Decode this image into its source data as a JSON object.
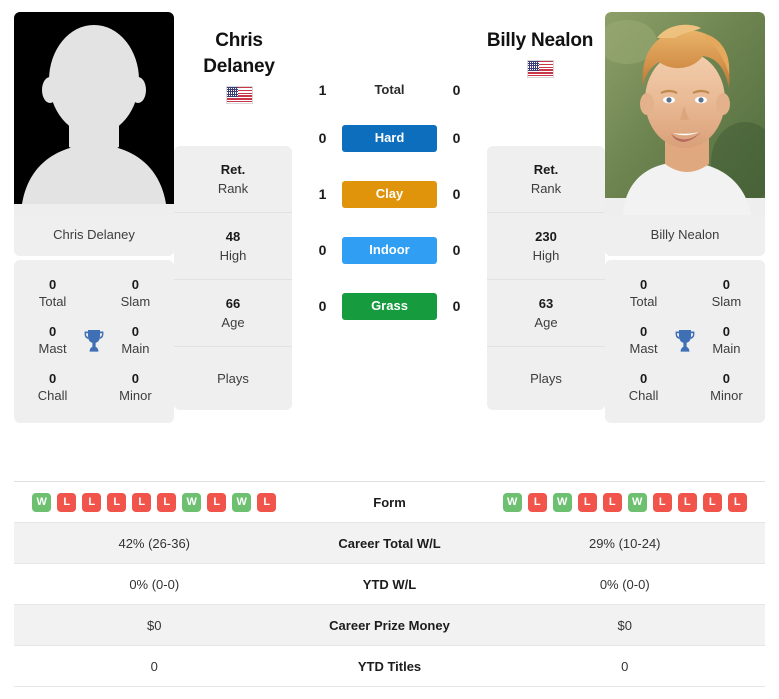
{
  "players": {
    "left": {
      "name_line1": "Chris",
      "name_line2": "Delaney",
      "full_name": "Chris Delaney",
      "country": "United States",
      "photo_type": "silhouette-placeholder",
      "rank": "Ret.",
      "rank_label": "Rank",
      "high": "48",
      "high_label": "High",
      "age": "66",
      "age_label": "Age",
      "plays": "Plays",
      "titles": {
        "total": "0",
        "total_label": "Total",
        "slam": "0",
        "slam_label": "Slam",
        "mast": "0",
        "mast_label": "Mast",
        "main": "0",
        "main_label": "Main",
        "chall": "0",
        "chall_label": "Chall",
        "minor": "0",
        "minor_label": "Minor"
      },
      "form": [
        "W",
        "L",
        "L",
        "L",
        "L",
        "L",
        "W",
        "L",
        "W",
        "L"
      ],
      "career_total_wl": "42% (26-36)",
      "ytd_wl": "0% (0-0)",
      "career_prize_money": "$0",
      "ytd_titles": "0"
    },
    "right": {
      "name_line1": "Billy Nealon",
      "name_line2": "",
      "full_name": "Billy Nealon",
      "country": "United States",
      "photo_type": "player-photo",
      "rank": "Ret.",
      "rank_label": "Rank",
      "high": "230",
      "high_label": "High",
      "age": "63",
      "age_label": "Age",
      "plays": "Plays",
      "titles": {
        "total": "0",
        "total_label": "Total",
        "slam": "0",
        "slam_label": "Slam",
        "mast": "0",
        "mast_label": "Mast",
        "main": "0",
        "main_label": "Main",
        "chall": "0",
        "chall_label": "Chall",
        "minor": "0",
        "minor_label": "Minor"
      },
      "form": [
        "W",
        "L",
        "W",
        "L",
        "L",
        "W",
        "L",
        "L",
        "L",
        "L"
      ],
      "career_total_wl": "29% (10-24)",
      "ytd_wl": "0% (0-0)",
      "career_prize_money": "$0",
      "ytd_titles": "0"
    }
  },
  "head_to_head": {
    "total": {
      "label": "Total",
      "left": "1",
      "right": "0"
    },
    "surfaces": [
      {
        "label": "Hard",
        "left": "0",
        "right": "0",
        "color": "#0d6ebd"
      },
      {
        "label": "Clay",
        "left": "1",
        "right": "0",
        "color": "#e0940c"
      },
      {
        "label": "Indoor",
        "left": "0",
        "right": "0",
        "color": "#2f9ef3"
      },
      {
        "label": "Grass",
        "left": "0",
        "right": "0",
        "color": "#169b3f"
      }
    ]
  },
  "table": {
    "rows": [
      {
        "label": "Form",
        "left": "",
        "right": "",
        "type": "form"
      },
      {
        "label": "Career Total W/L",
        "left": "42% (26-36)",
        "right": "29% (10-24)",
        "type": "text"
      },
      {
        "label": "YTD W/L",
        "left": "0% (0-0)",
        "right": "0% (0-0)",
        "type": "text"
      },
      {
        "label": "Career Prize Money",
        "left": "$0",
        "right": "$0",
        "type": "text"
      },
      {
        "label": "YTD Titles",
        "left": "0",
        "right": "0",
        "type": "text"
      }
    ]
  },
  "colors": {
    "card_bg": "#efefef",
    "win": "#6cc070",
    "loss": "#f0544a",
    "trophy": "#3f6fb5"
  }
}
